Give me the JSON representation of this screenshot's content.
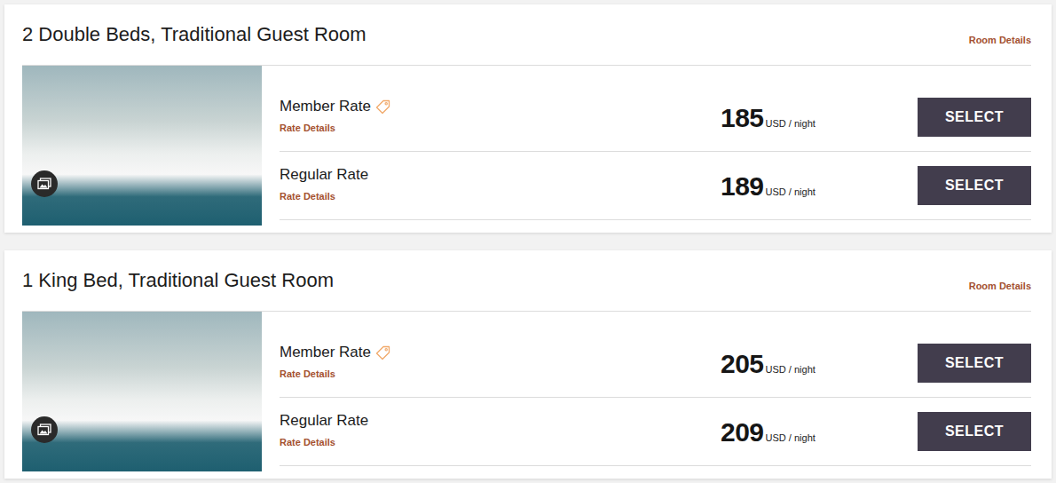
{
  "rooms": [
    {
      "title": "2 Double Beds, Traditional Guest Room",
      "details_link": "Room Details",
      "rates": [
        {
          "name": "Member Rate",
          "kind": "member",
          "details": "Rate Details",
          "price": "185",
          "unit": "USD / night",
          "button": "SELECT"
        },
        {
          "name": "Regular Rate",
          "kind": "regular",
          "details": "Rate Details",
          "price": "189",
          "unit": "USD / night",
          "button": "SELECT"
        }
      ]
    },
    {
      "title": "1 King Bed, Traditional Guest Room",
      "details_link": "Room Details",
      "rates": [
        {
          "name": "Member Rate",
          "kind": "member",
          "details": "Rate Details",
          "price": "205",
          "unit": "USD / night",
          "button": "SELECT"
        },
        {
          "name": "Regular Rate",
          "kind": "regular",
          "details": "Rate Details",
          "price": "209",
          "unit": "USD / night",
          "button": "SELECT"
        }
      ]
    }
  ]
}
